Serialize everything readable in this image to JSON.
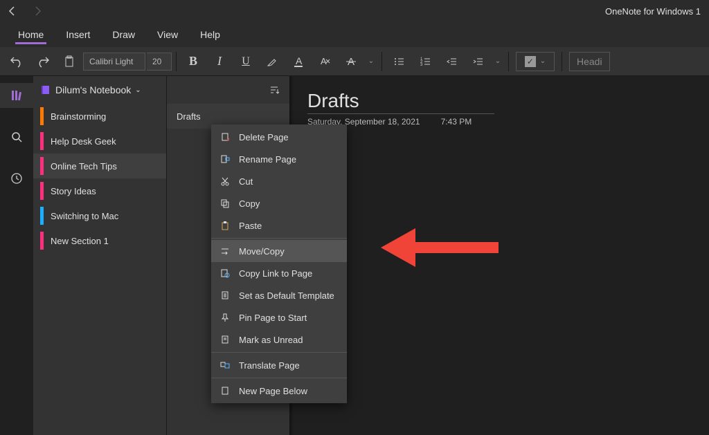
{
  "app_title": "OneNote for Windows 1",
  "menus": {
    "home": "Home",
    "insert": "Insert",
    "draw": "Draw",
    "view": "View",
    "help": "Help"
  },
  "toolbar": {
    "font": "Calibri Light",
    "size": "20",
    "heading": "Headi"
  },
  "notebook": {
    "name": "Dilum's Notebook"
  },
  "sections": [
    {
      "label": "Brainstorming",
      "color": "#ff7a00"
    },
    {
      "label": "Help Desk Geek",
      "color": "#ff2e7e"
    },
    {
      "label": "Online Tech Tips",
      "color": "#ff2e7e"
    },
    {
      "label": "Story Ideas",
      "color": "#ff2e7e"
    },
    {
      "label": "Switching to Mac",
      "color": "#1ab0ff"
    },
    {
      "label": "New Section 1",
      "color": "#ff2e7e"
    }
  ],
  "active_section_index": 2,
  "pages": [
    {
      "label": "Drafts"
    }
  ],
  "page": {
    "title": "Drafts",
    "date": "Saturday, September 18, 2021",
    "time": "7:43 PM"
  },
  "context_menu": {
    "items": [
      {
        "label": "Delete Page",
        "icon": "delete-icon"
      },
      {
        "label": "Rename Page",
        "icon": "rename-icon"
      },
      {
        "label": "Cut",
        "icon": "cut-icon"
      },
      {
        "label": "Copy",
        "icon": "copy-icon"
      },
      {
        "label": "Paste",
        "icon": "paste-icon"
      },
      {
        "label": "Move/Copy",
        "icon": "move-icon",
        "highlighted": true
      },
      {
        "label": "Copy Link to Page",
        "icon": "link-page-icon"
      },
      {
        "label": "Set as Default Template",
        "icon": "template-icon"
      },
      {
        "label": "Pin Page to Start",
        "icon": "pin-icon"
      },
      {
        "label": "Mark as Unread",
        "icon": "unread-icon"
      },
      {
        "label": "Translate Page",
        "icon": "translate-icon"
      },
      {
        "label": "New Page Below",
        "icon": "new-page-icon"
      }
    ],
    "separators_after": [
      4,
      9,
      10
    ]
  }
}
